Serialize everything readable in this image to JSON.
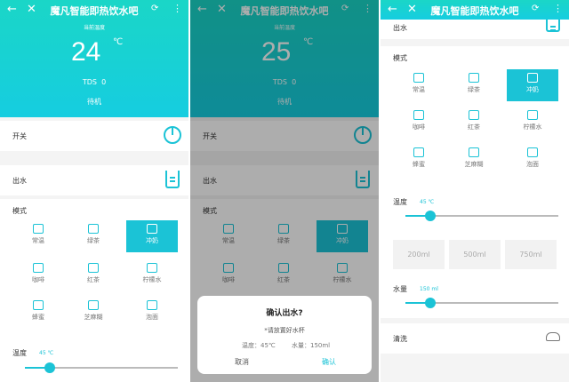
{
  "app": {
    "title": "魔凡智能即热饮水吧"
  },
  "header": {
    "current_temp_label": "当前温度",
    "unit": "℃",
    "tds_label": "TDS",
    "tds_value": "0",
    "status": "待机"
  },
  "screens": [
    {
      "temp": "24"
    },
    {
      "temp": "25"
    }
  ],
  "controls": {
    "power_label": "开关",
    "water_label": "出水",
    "mode_label": "模式"
  },
  "modes": [
    {
      "name": "常温",
      "icon": "kettle-icon"
    },
    {
      "name": "绿茶",
      "icon": "tea-cup-icon"
    },
    {
      "name": "冲奶",
      "icon": "baby-bottle-icon"
    },
    {
      "name": "咖啡",
      "icon": "coffee-icon"
    },
    {
      "name": "红茶",
      "icon": "black-tea-icon"
    },
    {
      "name": "柠檬水",
      "icon": "lemon-water-icon"
    },
    {
      "name": "蜂蜜",
      "icon": "honey-jar-icon"
    },
    {
      "name": "芝麻糊",
      "icon": "sesame-bowl-icon"
    },
    {
      "name": "泡面",
      "icon": "noodle-bowl-icon"
    }
  ],
  "selected_mode": "冲奶",
  "temperature": {
    "label": "温度",
    "value": "45 ℃",
    "level": 0.16
  },
  "dialog": {
    "title": "确认出水?",
    "note": "*请放置好水杯",
    "temp_text": "温度：45℃",
    "volume_text": "水量：150ml",
    "cancel": "取消",
    "ok": "确认"
  },
  "volume": {
    "label": "水量",
    "value": "150 ml",
    "level": 0.16,
    "options": [
      "200ml",
      "500ml",
      "750ml"
    ]
  },
  "clean": {
    "label": "清洗"
  },
  "colors": {
    "accent": "#1bc3d6",
    "header_top": "#1ad6c7",
    "header_bottom": "#16cde0"
  }
}
